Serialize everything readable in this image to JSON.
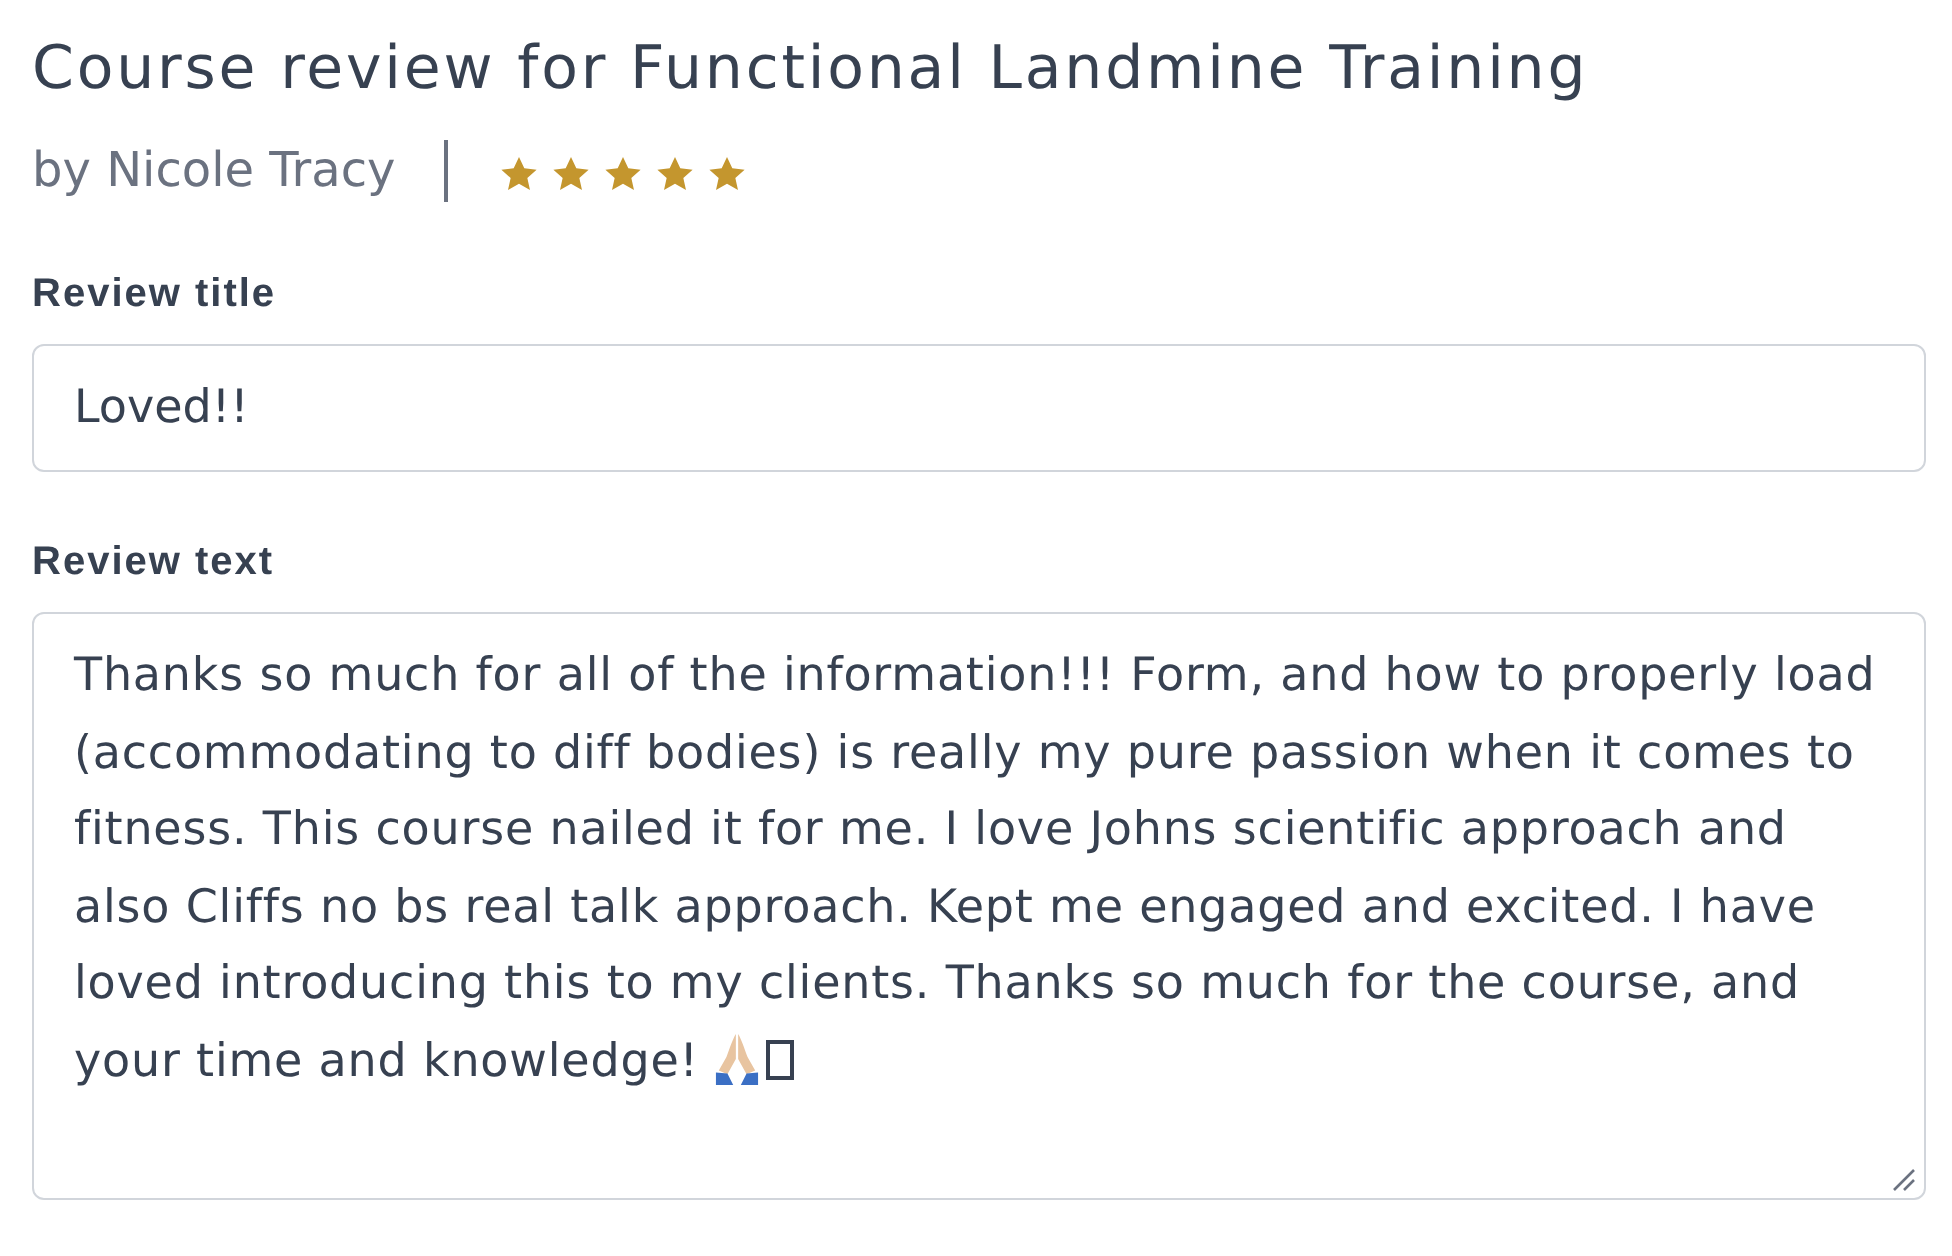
{
  "course_review": {
    "title": "Course review for Functional Landmine Training",
    "author": "by Nicole Tracy",
    "rating": {
      "stars": 5
    }
  },
  "review_title": {
    "label": "Review title",
    "value": "Loved!!"
  },
  "review_text": {
    "label": "Review text",
    "value": "Thanks so much for all of the information!!! Form, and how to properly load (accommodating to diff bodies) is really my pure passion when it comes to fitness. This course nailed it for me. I love Johns scientific approach and also Cliffs no bs real talk approach. Kept me engaged and excited. I have loved introducing this to my clients. Thanks so much for the course, and your time and knowledge!"
  }
}
